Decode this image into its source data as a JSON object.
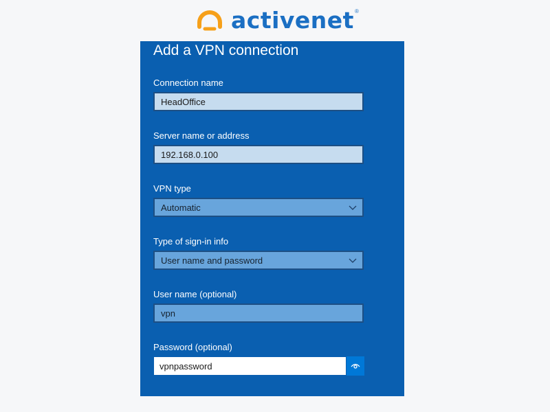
{
  "brand": {
    "name": "activenet",
    "registered_mark": "®",
    "colors": {
      "orange": "#f6a01a",
      "blue": "#1b6fc3"
    }
  },
  "panel": {
    "title": "Add a VPN connection",
    "background": "#0a5fb0",
    "connection_name": {
      "label": "Connection name",
      "value": "HeadOffice"
    },
    "server": {
      "label": "Server name or address",
      "value": "192.168.0.100"
    },
    "vpn_type": {
      "label": "VPN type",
      "value": "Automatic"
    },
    "signin_type": {
      "label": "Type of sign-in info",
      "value": "User name and password"
    },
    "username": {
      "label": "User name (optional)",
      "value": "vpn"
    },
    "password": {
      "label": "Password (optional)",
      "value": "vpnpassword"
    }
  },
  "icons": {
    "dropdown": "chevron-down-icon",
    "reveal": "eye-icon",
    "logo": "activenet-logo-icon"
  }
}
